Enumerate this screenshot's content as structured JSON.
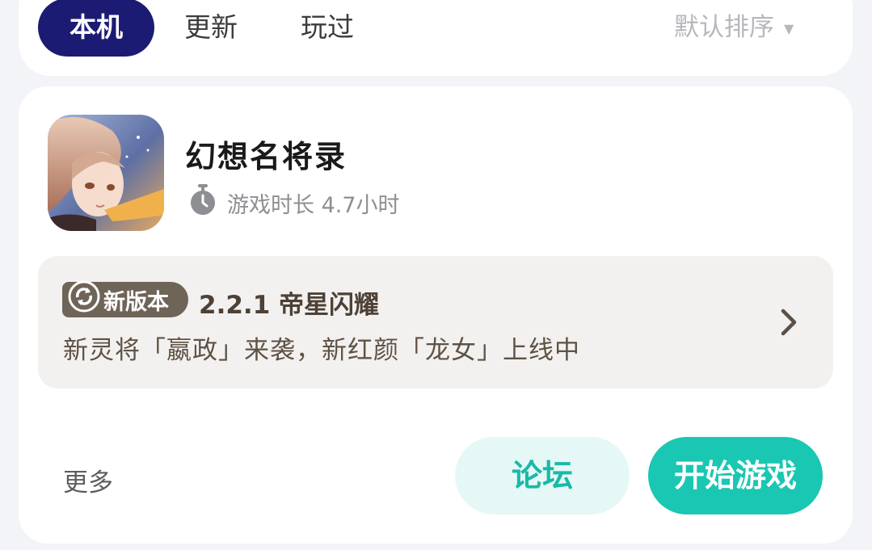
{
  "tabs": [
    {
      "label": "本机",
      "active": true
    },
    {
      "label": "更新",
      "active": false
    },
    {
      "label": "玩过",
      "active": false
    }
  ],
  "sort": {
    "label": "默认排序",
    "icon": "caret-down-icon"
  },
  "game": {
    "title": "幻想名将录",
    "playtime": "游戏时长 4.7小时",
    "playtime_icon": "stopwatch-icon",
    "update": {
      "badge_label": "新版本",
      "badge_icon": "refresh-icon",
      "version": "2.2.1 帝星闪耀",
      "description": "新灵将「嬴政」来袭，新红颜「龙女」上线中",
      "chevron_icon": "chevron-right-icon"
    },
    "actions": {
      "more": "更多",
      "forum": "论坛",
      "play": "开始游戏"
    }
  },
  "colors": {
    "accent_navy": "#1c1b74",
    "accent_teal": "#1ac7b2",
    "badge_brown": "#6f6458"
  }
}
